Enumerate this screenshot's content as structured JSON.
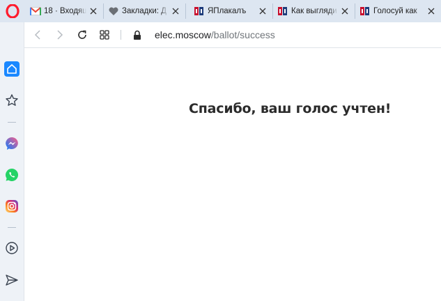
{
  "tabs": [
    {
      "favicon": "gmail-icon",
      "label": "18 · Входящи"
    },
    {
      "favicon": "heart-icon",
      "label": "Закладки: Д"
    },
    {
      "favicon": "yaplakal-icon",
      "label": "ЯПлакалъ"
    },
    {
      "favicon": "yaplakal-icon",
      "label": "Как выгляди"
    },
    {
      "favicon": "yaplakal-icon",
      "label": "Голосуй как"
    }
  ],
  "address_bar": {
    "domain": "elec.moscow",
    "path": "/ballot/success"
  },
  "sidebar": {
    "items": [
      "home-icon",
      "star-icon",
      "messenger-icon",
      "whatsapp-icon",
      "instagram-icon",
      "player-icon",
      "send-icon"
    ]
  },
  "page": {
    "message": "Спасибо, ваш голос учтен!"
  },
  "colors": {
    "opera_red": "#ff1b2d",
    "active_home": "#1a88ff",
    "tabbar_bg": "#dde6f1"
  }
}
